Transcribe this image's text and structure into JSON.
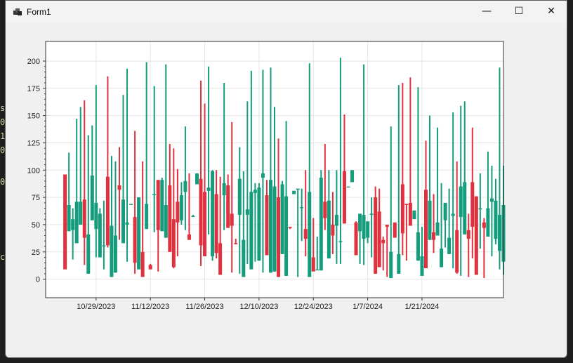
{
  "window": {
    "title": "Form1"
  },
  "controls": {
    "minimize": "—",
    "maximize": "☐",
    "close": "✕"
  },
  "background": {
    "lines": [
      "s",
      "0",
      "1",
      "0",
      "",
      "0",
      "",
      "",
      "c"
    ]
  },
  "colors": {
    "up": "#149c7c",
    "down": "#e0313f",
    "grid": "#e6e6e6",
    "frame": "#333333"
  },
  "chart_data": {
    "type": "candlestick",
    "title": "",
    "xlabel": "",
    "ylabel": "",
    "x_range": [
      "2023-10-16",
      "2024-02-11"
    ],
    "ylim": [
      -17,
      218
    ],
    "y_ticks": [
      0,
      25,
      50,
      75,
      100,
      125,
      150,
      175,
      200
    ],
    "x_ticks": [
      {
        "date": "2023-10-29",
        "label": "10/29/2023"
      },
      {
        "date": "2023-11-12",
        "label": "11/12/2023"
      },
      {
        "date": "2023-11-26",
        "label": "11/26/2023"
      },
      {
        "date": "2023-12-10",
        "label": "12/10/2023"
      },
      {
        "date": "2023-12-24",
        "label": "12/24/2023"
      },
      {
        "date": "2024-01-07",
        "label": "1/7/2024"
      },
      {
        "date": "2024-01-21",
        "label": "1/21/2024"
      }
    ],
    "grid": true,
    "start_date": "2023-10-21",
    "series": [
      [
        96,
        96,
        9,
        9
      ],
      [
        44,
        116,
        44,
        68
      ],
      [
        45,
        65,
        18,
        55
      ],
      [
        33,
        147,
        33,
        71
      ],
      [
        50,
        158,
        50,
        71
      ],
      [
        73,
        164,
        13,
        38
      ],
      [
        5,
        132,
        5,
        41
      ],
      [
        54,
        141,
        54,
        95
      ],
      [
        46,
        178,
        20,
        70
      ],
      [
        20,
        65,
        20,
        60
      ],
      [
        31,
        72,
        9,
        31
      ],
      [
        94,
        186,
        29,
        31
      ],
      [
        2,
        113,
        2,
        49
      ],
      [
        6,
        108,
        6,
        40
      ],
      [
        86,
        121,
        36,
        82
      ],
      [
        33,
        169,
        33,
        73
      ],
      [
        50,
        193,
        16,
        52
      ],
      [
        69,
        68,
        68,
        69
      ],
      [
        57,
        136,
        5,
        15
      ],
      [
        9,
        75,
        9,
        75
      ],
      [
        25,
        108,
        25,
        2
      ],
      [
        46,
        199,
        46,
        69
      ],
      [
        13,
        14,
        9,
        9
      ],
      [
        78,
        177,
        43,
        78
      ],
      [
        91,
        91,
        7,
        45
      ],
      [
        44,
        93,
        44,
        91
      ],
      [
        38,
        197,
        38,
        68
      ],
      [
        86,
        124,
        25,
        25
      ],
      [
        55,
        120,
        10,
        11
      ],
      [
        71,
        101,
        21,
        52
      ],
      [
        54,
        89,
        50,
        77
      ],
      [
        80,
        140,
        45,
        90
      ],
      [
        41,
        97,
        36,
        36
      ],
      [
        58,
        59,
        57,
        58
      ],
      [
        87,
        96,
        87,
        97
      ],
      [
        92,
        182,
        12,
        31
      ],
      [
        80,
        161,
        22,
        21
      ],
      [
        81,
        195,
        41,
        84
      ],
      [
        21,
        100,
        17,
        99
      ],
      [
        78,
        100,
        19,
        24
      ],
      [
        33,
        94,
        12,
        4
      ],
      [
        77,
        180,
        45,
        88
      ],
      [
        86,
        96,
        47,
        47
      ],
      [
        60,
        144,
        6,
        49
      ],
      [
        33,
        37,
        32,
        32
      ],
      [
        59,
        121,
        5,
        92
      ],
      [
        2,
        99,
        2,
        36
      ],
      [
        59,
        163,
        14,
        64
      ],
      [
        9,
        191,
        9,
        80
      ],
      [
        79,
        88,
        16,
        82
      ],
      [
        17,
        88,
        17,
        84
      ],
      [
        93,
        192,
        6,
        97
      ],
      [
        77,
        91,
        24,
        22
      ],
      [
        6,
        194,
        6,
        91
      ],
      [
        7,
        158,
        7,
        85
      ],
      [
        75,
        129,
        34,
        2
      ],
      [
        23,
        90,
        23,
        87
      ],
      [
        3,
        145,
        3,
        76
      ],
      [
        48,
        47,
        46,
        47
      ],
      [
        78,
        81,
        78,
        81
      ],
      [
        83,
        83,
        2,
        83
      ],
      [
        66,
        83,
        35,
        66
      ],
      [
        46,
        100,
        21,
        37
      ],
      [
        2,
        198,
        2,
        80
      ],
      [
        20,
        56,
        20,
        7
      ],
      [
        9,
        39,
        9,
        9
      ],
      [
        8,
        100,
        8,
        93
      ],
      [
        71,
        124,
        45,
        56
      ],
      [
        19,
        100,
        19,
        72
      ],
      [
        50,
        80,
        23,
        40
      ],
      [
        49,
        100,
        14,
        59
      ],
      [
        35,
        203,
        14,
        35
      ],
      [
        99,
        151,
        51,
        51
      ],
      [
        85,
        82,
        82,
        85
      ],
      [
        89,
        98,
        89,
        100
      ],
      [
        52,
        53,
        22,
        22
      ],
      [
        44,
        58,
        14,
        60
      ],
      [
        37,
        197,
        13,
        59
      ],
      [
        38,
        38,
        33,
        53
      ],
      [
        60,
        75,
        20,
        60
      ],
      [
        75,
        85,
        5,
        5
      ],
      [
        62,
        83,
        24,
        11
      ],
      [
        36,
        39,
        8,
        33
      ],
      [
        50,
        49,
        2,
        48
      ],
      [
        1,
        140,
        1,
        25
      ],
      [
        52,
        46,
        38,
        38
      ],
      [
        5,
        178,
        5,
        23
      ],
      [
        87,
        180,
        22,
        42
      ],
      [
        69,
        69,
        17,
        68
      ],
      [
        70,
        185,
        70,
        49
      ],
      [
        55,
        45,
        45,
        63
      ],
      [
        17,
        176,
        17,
        43
      ],
      [
        3,
        48,
        3,
        21
      ],
      [
        82,
        127,
        48,
        10
      ],
      [
        36,
        150,
        36,
        72
      ],
      [
        43,
        78,
        24,
        36
      ],
      [
        40,
        139,
        40,
        52
      ],
      [
        11,
        88,
        11,
        28
      ],
      [
        54,
        68,
        29,
        70
      ],
      [
        23,
        83,
        23,
        38
      ],
      [
        58,
        153,
        10,
        60
      ],
      [
        45,
        108,
        5,
        6
      ],
      [
        57,
        159,
        3,
        85
      ],
      [
        41,
        163,
        41,
        89
      ],
      [
        45,
        60,
        2,
        37
      ],
      [
        89,
        139,
        19,
        48
      ],
      [
        76,
        30,
        6,
        4
      ],
      [
        65,
        97,
        28,
        65
      ],
      [
        52,
        56,
        1,
        47
      ],
      [
        39,
        117,
        39,
        65
      ],
      [
        71,
        104,
        21,
        74
      ],
      [
        37,
        92,
        32,
        72
      ],
      [
        26,
        194,
        9,
        59
      ],
      [
        16,
        104,
        4,
        68
      ]
    ]
  }
}
